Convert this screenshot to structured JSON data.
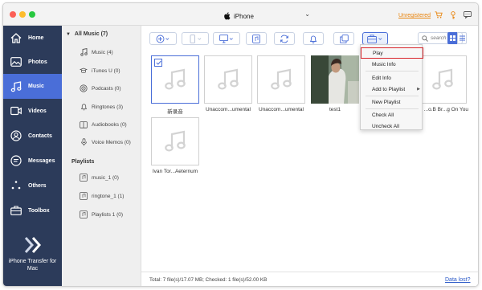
{
  "titlebar": {
    "device_name": "iPhone",
    "unregistered_label": "Unregistered",
    "dot_colors": [
      "#fc5f57",
      "#fdbc2e",
      "#28c840"
    ]
  },
  "sidebar": {
    "items": [
      {
        "label": "Home",
        "icon": "home-icon"
      },
      {
        "label": "Photos",
        "icon": "photos-icon"
      },
      {
        "label": "Music",
        "icon": "music-icon",
        "active": true
      },
      {
        "label": "Videos",
        "icon": "videos-icon"
      },
      {
        "label": "Contacts",
        "icon": "contacts-icon"
      },
      {
        "label": "Messages",
        "icon": "messages-icon"
      },
      {
        "label": "Others",
        "icon": "others-icon"
      },
      {
        "label": "Toolbox",
        "icon": "toolbox-icon"
      }
    ],
    "brand_line1": "iPhone Transfer for",
    "brand_line2": "Mac",
    "background": "#2c3b5a",
    "active_color": "#4a6ed8"
  },
  "categories": {
    "all_music_label": "All Music (7)",
    "items": [
      {
        "label": "Music (4)",
        "icon": "music-note-icon"
      },
      {
        "label": "iTunes U (0)",
        "icon": "itunes-u-icon"
      },
      {
        "label": "Podcasts (0)",
        "icon": "podcast-icon"
      },
      {
        "label": "Ringtones (3)",
        "icon": "bell-icon"
      },
      {
        "label": "Audiobooks (0)",
        "icon": "audiobook-icon"
      },
      {
        "label": "Voice Memos (0)",
        "icon": "microphone-icon"
      }
    ],
    "playlists_label": "Playlists",
    "playlists": [
      {
        "label": "music_1 (0)"
      },
      {
        "label": "ringtone_1 (1)"
      },
      {
        "label": "Playlists 1 (0)"
      }
    ]
  },
  "toolbar": {
    "search_placeholder": "search"
  },
  "files": [
    {
      "name": "新录音",
      "selected": true
    },
    {
      "name": "Unaccom...umental"
    },
    {
      "name": "Unaccom...umental"
    },
    {
      "name": "test1",
      "video_thumb": true
    },
    {
      "name": "...o.B Br...g On You"
    },
    {
      "name": "Ivan Tor...Aeternum"
    }
  ],
  "context_menu": {
    "items": [
      "Play",
      "Music Info",
      "Edit Info",
      "Add to Playlist",
      "New Playlist",
      "Check All",
      "Uncheck All"
    ],
    "highlighted": "Play"
  },
  "status": {
    "text": "Total: 7 file(s)/17.07 MB; Checked: 1 file(s)/52.00 KB",
    "data_lost_label": "Data lost?"
  }
}
